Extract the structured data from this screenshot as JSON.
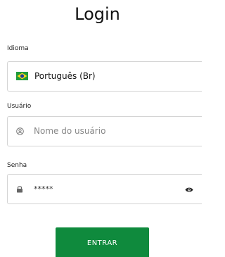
{
  "title": "Login",
  "language": {
    "label": "Idioma",
    "value": "Português (Br)",
    "flag_icon": "brazil-flag-icon"
  },
  "username": {
    "label": "Usuário",
    "placeholder": "Nome do usuário",
    "icon": "user-icon"
  },
  "password": {
    "label": "Senha",
    "value": "*****",
    "lock_icon": "lock-icon",
    "toggle_icon": "eye-icon"
  },
  "submit": {
    "label": "ENTRAR",
    "color": "#0f8a3d"
  }
}
